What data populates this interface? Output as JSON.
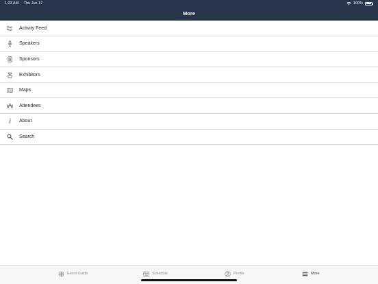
{
  "status": {
    "time": "1:23 AM",
    "date": "Thu Jun 17",
    "battery": "100%"
  },
  "header": {
    "title": "More"
  },
  "menu": {
    "items": [
      {
        "label": "Activity Feed",
        "icon": "activity-feed-icon"
      },
      {
        "label": "Speakers",
        "icon": "microphone-icon"
      },
      {
        "label": "Sponsors",
        "icon": "award-icon"
      },
      {
        "label": "Exhibitors",
        "icon": "booth-icon"
      },
      {
        "label": "Maps",
        "icon": "map-icon"
      },
      {
        "label": "Attendees",
        "icon": "attendees-icon"
      },
      {
        "label": "About",
        "icon": "info-icon"
      },
      {
        "label": "Search",
        "icon": "search-icon"
      }
    ]
  },
  "tabbar": {
    "tabs": [
      {
        "label": "Event Guide",
        "icon": "signpost-icon"
      },
      {
        "label": "Schedule",
        "icon": "calendar-icon"
      },
      {
        "label": "Profile",
        "icon": "profile-icon"
      },
      {
        "label": "More",
        "icon": "menu-icon",
        "active": true
      }
    ]
  },
  "colors": {
    "header_bg": "#27364a",
    "active_tab": "#27364a",
    "inactive_tab": "#8a8a8a"
  }
}
